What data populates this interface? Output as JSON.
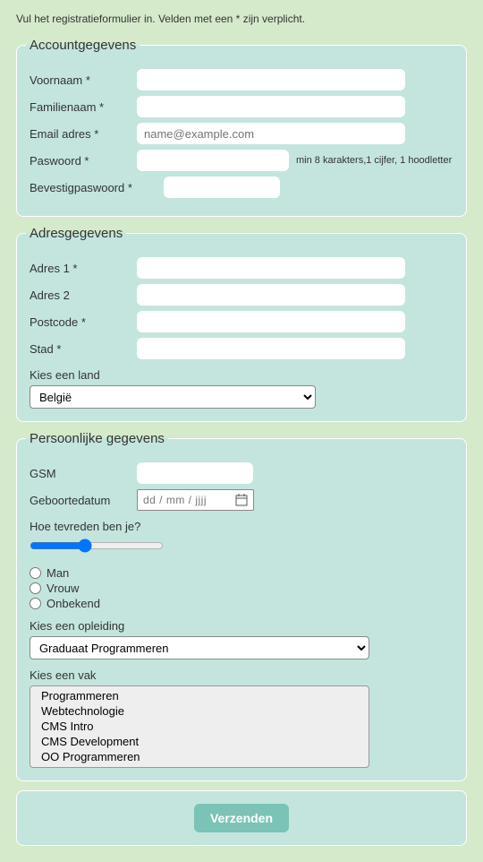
{
  "intro": "Vul het registratieformulier in. Velden met een * zijn verplicht.",
  "account": {
    "legend": "Accountgegevens",
    "voornaam_label": "Voornaam *",
    "familienaam_label": "Familienaam *",
    "email_label": "Email adres *",
    "email_placeholder": "name@example.com",
    "paswoord_label": "Paswoord *",
    "paswoord_hint": "min 8 karakters,1 cijfer, 1 hoodletter",
    "bevestig_label": "Bevestigpaswoord *"
  },
  "adres": {
    "legend": "Adresgegevens",
    "adres1_label": "Adres 1 *",
    "adres2_label": "Adres 2",
    "postcode_label": "Postcode *",
    "stad_label": "Stad *",
    "land_label": "Kies een land",
    "land_selected": "België"
  },
  "persoonlijk": {
    "legend": "Persoonlijke gegevens",
    "gsm_label": "GSM",
    "geboortedatum_label": "Geboortedatum",
    "geboortedatum_placeholder": "dd / mm / jjjj",
    "tevreden_label": "Hoe tevreden ben je?",
    "geslacht": {
      "man": "Man",
      "vrouw": "Vrouw",
      "onbekend": "Onbekend"
    },
    "opleiding_label": "Kies een opleiding",
    "opleiding_selected": "Graduaat Programmeren",
    "vak_label": "Kies een vak",
    "vakken": [
      "Programmeren",
      "Webtechnologie",
      "CMS Intro",
      "CMS Development",
      "OO Programmeren"
    ]
  },
  "submit_label": "Verzenden"
}
